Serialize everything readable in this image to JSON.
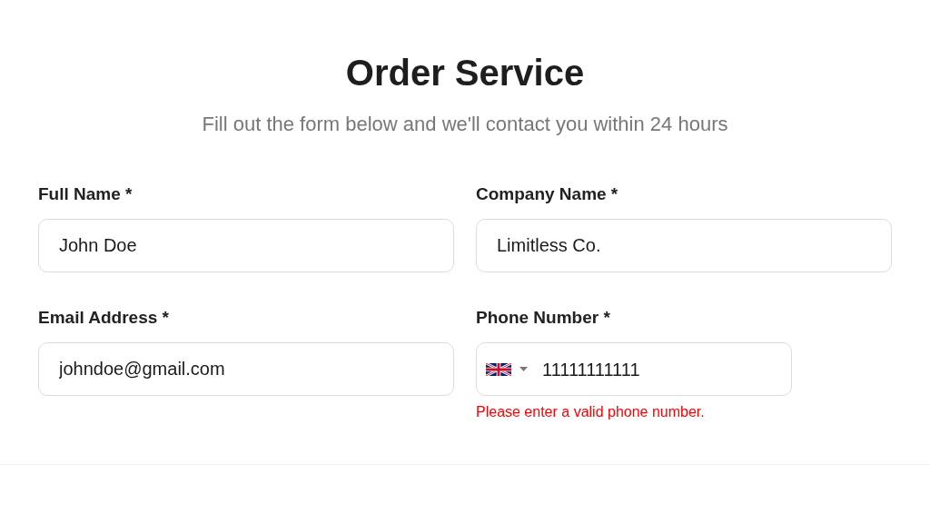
{
  "title": "Order Service",
  "subtitle": "Fill out the form below and we'll contact you within 24 hours",
  "fields": [
    {
      "kind": "text",
      "label": "Full Name *",
      "value": "John Doe"
    },
    {
      "kind": "text",
      "label": "Company Name *",
      "value": "Limitless Co."
    },
    {
      "kind": "text",
      "label": "Email Address *",
      "value": "johndoe@gmail.com"
    },
    {
      "kind": "phone",
      "label": "Phone Number *",
      "value": "11111111111",
      "error": "Please enter a valid phone number."
    }
  ]
}
